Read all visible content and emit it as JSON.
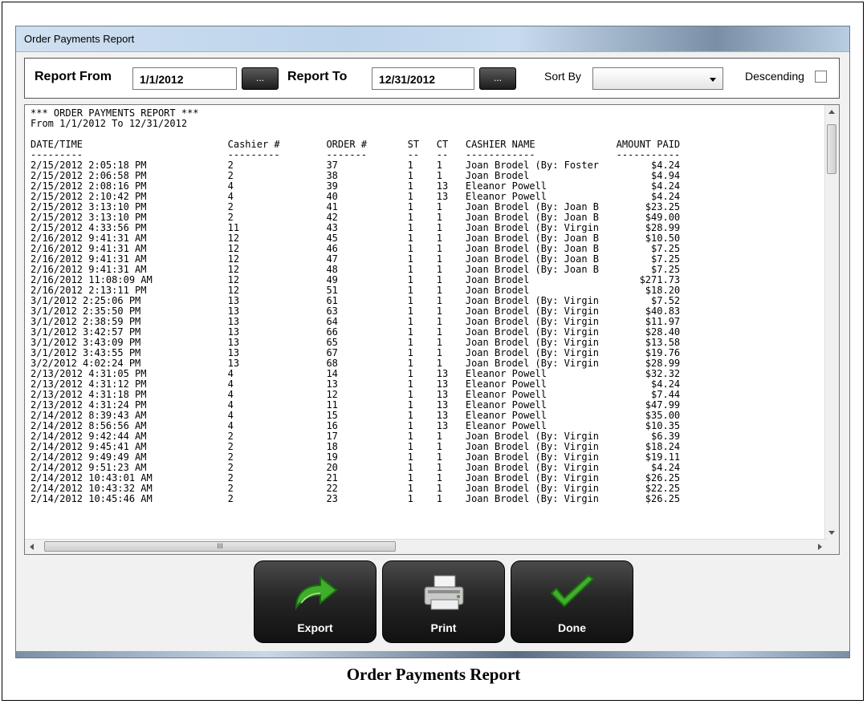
{
  "window": {
    "title": "Order Payments Report"
  },
  "params": {
    "report_from_label": "Report From",
    "report_from_value": "1/1/2012",
    "report_to_label": "Report To",
    "report_to_value": "12/31/2012",
    "picker_label": "...",
    "sort_by_label": "Sort By",
    "sort_by_value": "",
    "descending_label": "Descending",
    "descending_checked": false
  },
  "report": {
    "header_line": "*** ORDER PAYMENTS REPORT ***",
    "range_line": "From 1/1/2012 To 12/31/2012",
    "columns": [
      "DATE/TIME",
      "Cashier #",
      "ORDER #",
      "ST",
      "CT",
      "CASHIER NAME",
      "AMOUNT PAID"
    ],
    "rows": [
      [
        "2/15/2012 2:05:18 PM",
        "2",
        "37",
        "1",
        "1",
        "Joan Brodel (By: Foster",
        "$4.24"
      ],
      [
        "2/15/2012 2:06:58 PM",
        "2",
        "38",
        "1",
        "1",
        "Joan Brodel",
        "$4.94"
      ],
      [
        "2/15/2012 2:08:16 PM",
        "4",
        "39",
        "1",
        "13",
        "Eleanor Powell",
        "$4.24"
      ],
      [
        "2/15/2012 2:10:42 PM",
        "4",
        "40",
        "1",
        "13",
        "Eleanor Powell",
        "$4.24"
      ],
      [
        "2/15/2012 3:13:10 PM",
        "2",
        "41",
        "1",
        "1",
        "Joan Brodel (By: Joan B",
        "$23.25"
      ],
      [
        "2/15/2012 3:13:10 PM",
        "2",
        "42",
        "1",
        "1",
        "Joan Brodel (By: Joan B",
        "$49.00"
      ],
      [
        "2/15/2012 4:33:56 PM",
        "11",
        "43",
        "1",
        "1",
        "Joan Brodel (By: Virgin",
        "$28.99"
      ],
      [
        "2/16/2012 9:41:31 AM",
        "12",
        "45",
        "1",
        "1",
        "Joan Brodel (By: Joan B",
        "$10.50"
      ],
      [
        "2/16/2012 9:41:31 AM",
        "12",
        "46",
        "1",
        "1",
        "Joan Brodel (By: Joan B",
        "$7.25"
      ],
      [
        "2/16/2012 9:41:31 AM",
        "12",
        "47",
        "1",
        "1",
        "Joan Brodel (By: Joan B",
        "$7.25"
      ],
      [
        "2/16/2012 9:41:31 AM",
        "12",
        "48",
        "1",
        "1",
        "Joan Brodel (By: Joan B",
        "$7.25"
      ],
      [
        "2/16/2012 11:08:09 AM",
        "12",
        "49",
        "1",
        "1",
        "Joan Brodel",
        "$271.73"
      ],
      [
        "2/16/2012 2:13:11 PM",
        "12",
        "51",
        "1",
        "1",
        "Joan Brodel",
        "$18.20"
      ],
      [
        "3/1/2012 2:25:06 PM",
        "13",
        "61",
        "1",
        "1",
        "Joan Brodel (By: Virgin",
        "$7.52"
      ],
      [
        "3/1/2012 2:35:50 PM",
        "13",
        "63",
        "1",
        "1",
        "Joan Brodel (By: Virgin",
        "$40.83"
      ],
      [
        "3/1/2012 2:38:59 PM",
        "13",
        "64",
        "1",
        "1",
        "Joan Brodel (By: Virgin",
        "$11.97"
      ],
      [
        "3/1/2012 3:42:57 PM",
        "13",
        "66",
        "1",
        "1",
        "Joan Brodel (By: Virgin",
        "$28.40"
      ],
      [
        "3/1/2012 3:43:09 PM",
        "13",
        "65",
        "1",
        "1",
        "Joan Brodel (By: Virgin",
        "$13.58"
      ],
      [
        "3/1/2012 3:43:55 PM",
        "13",
        "67",
        "1",
        "1",
        "Joan Brodel (By: Virgin",
        "$19.76"
      ],
      [
        "3/2/2012 4:02:24 PM",
        "13",
        "68",
        "1",
        "1",
        "Joan Brodel (By: Virgin",
        "$28.99"
      ],
      [
        "2/13/2012 4:31:05 PM",
        "4",
        "14",
        "1",
        "13",
        "Eleanor Powell",
        "$32.32"
      ],
      [
        "2/13/2012 4:31:12 PM",
        "4",
        "13",
        "1",
        "13",
        "Eleanor Powell",
        "$4.24"
      ],
      [
        "2/13/2012 4:31:18 PM",
        "4",
        "12",
        "1",
        "13",
        "Eleanor Powell",
        "$7.44"
      ],
      [
        "2/13/2012 4:31:24 PM",
        "4",
        "11",
        "1",
        "13",
        "Eleanor Powell",
        "$47.99"
      ],
      [
        "2/14/2012 8:39:43 AM",
        "4",
        "15",
        "1",
        "13",
        "Eleanor Powell",
        "$35.00"
      ],
      [
        "2/14/2012 8:56:56 AM",
        "4",
        "16",
        "1",
        "13",
        "Eleanor Powell",
        "$10.35"
      ],
      [
        "2/14/2012 9:42:44 AM",
        "2",
        "17",
        "1",
        "1",
        "Joan Brodel (By: Virgin",
        "$6.39"
      ],
      [
        "2/14/2012 9:45:41 AM",
        "2",
        "18",
        "1",
        "1",
        "Joan Brodel (By: Virgin",
        "$18.24"
      ],
      [
        "2/14/2012 9:49:49 AM",
        "2",
        "19",
        "1",
        "1",
        "Joan Brodel (By: Virgin",
        "$19.11"
      ],
      [
        "2/14/2012 9:51:23 AM",
        "2",
        "20",
        "1",
        "1",
        "Joan Brodel (By: Virgin",
        "$4.24"
      ],
      [
        "2/14/2012 10:43:01 AM",
        "2",
        "21",
        "1",
        "1",
        "Joan Brodel (By: Virgin",
        "$26.25"
      ],
      [
        "2/14/2012 10:43:32 AM",
        "2",
        "22",
        "1",
        "1",
        "Joan Brodel (By: Virgin",
        "$22.25"
      ],
      [
        "2/14/2012 10:45:46 AM",
        "2",
        "23",
        "1",
        "1",
        "Joan Brodel (By: Virgin",
        "$26.25"
      ]
    ]
  },
  "scrollbar": {
    "grip": "III"
  },
  "buttons": {
    "export": "Export",
    "print": "Print",
    "done": "Done"
  },
  "icons": {
    "export": "export-arrow-icon",
    "print": "printer-icon",
    "done": "checkmark-icon"
  },
  "colors": {
    "button_bg": "#1f1f1f",
    "check_green": "#3fae2a"
  },
  "caption": "Order Payments Report"
}
